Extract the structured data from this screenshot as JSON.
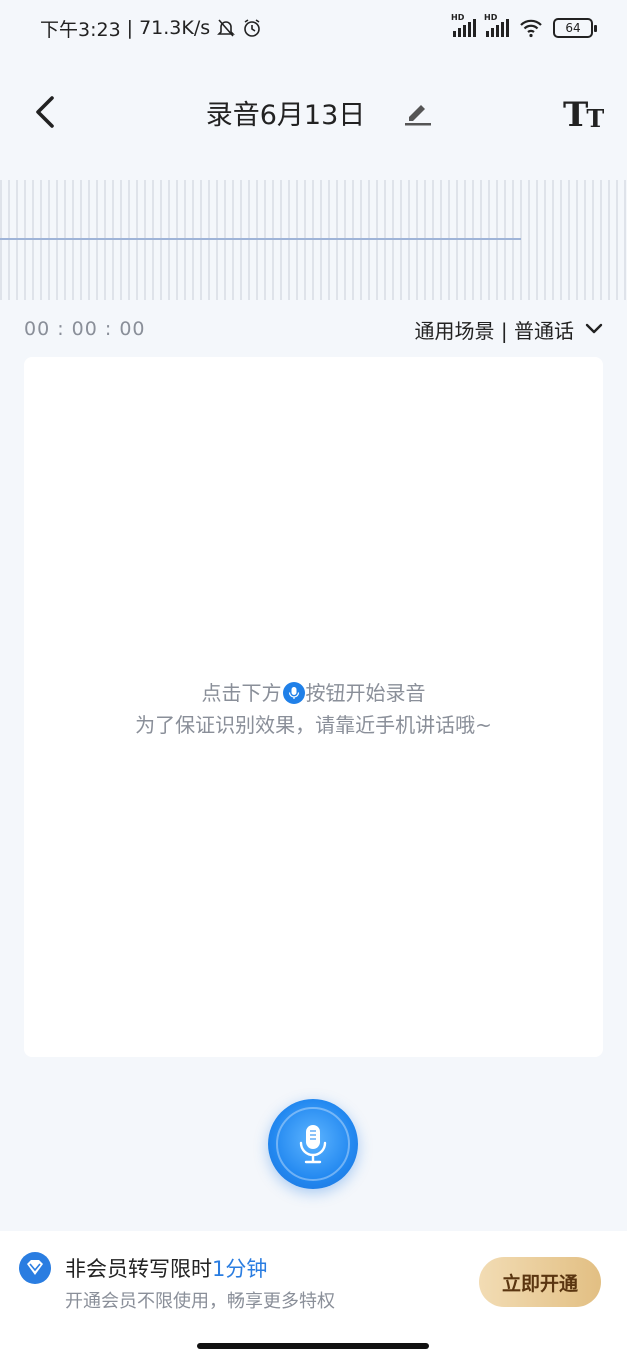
{
  "status_bar": {
    "time": "下午3:23",
    "network_speed": "71.3K/s",
    "signal_label": "HD",
    "battery": "64",
    "icons": [
      "mute-bell-icon",
      "alarm-icon",
      "signal-icon",
      "wifi-icon",
      "battery-icon"
    ]
  },
  "header": {
    "title": "录音6月13日",
    "font_button_big": "T",
    "font_button_small": "T",
    "icons": [
      "back-arrow-icon",
      "edit-pencil-icon",
      "font-size-icon"
    ]
  },
  "recorder": {
    "timer": "00 : 00 : 00",
    "scene": "通用场景 | 普通话",
    "hint_before_icon": "点击下方",
    "hint_after_icon": "按钮开始录音",
    "hint_line2": "为了保证识别效果，请靠近手机讲话哦~",
    "icons": [
      "chevron-down-icon",
      "microphone-icon"
    ]
  },
  "membership": {
    "title_prefix": "非会员转写限时",
    "title_accent": "1分钟",
    "subtitle": "开通会员不限使用，畅享更多特权",
    "cta": "立即开通",
    "icons": [
      "vip-diamond-icon"
    ]
  },
  "colors": {
    "accent_blue": "#2a7de1",
    "record_button": "#2288f0",
    "cta_gold": "#e2bf83",
    "background": "#f4f7fb"
  }
}
